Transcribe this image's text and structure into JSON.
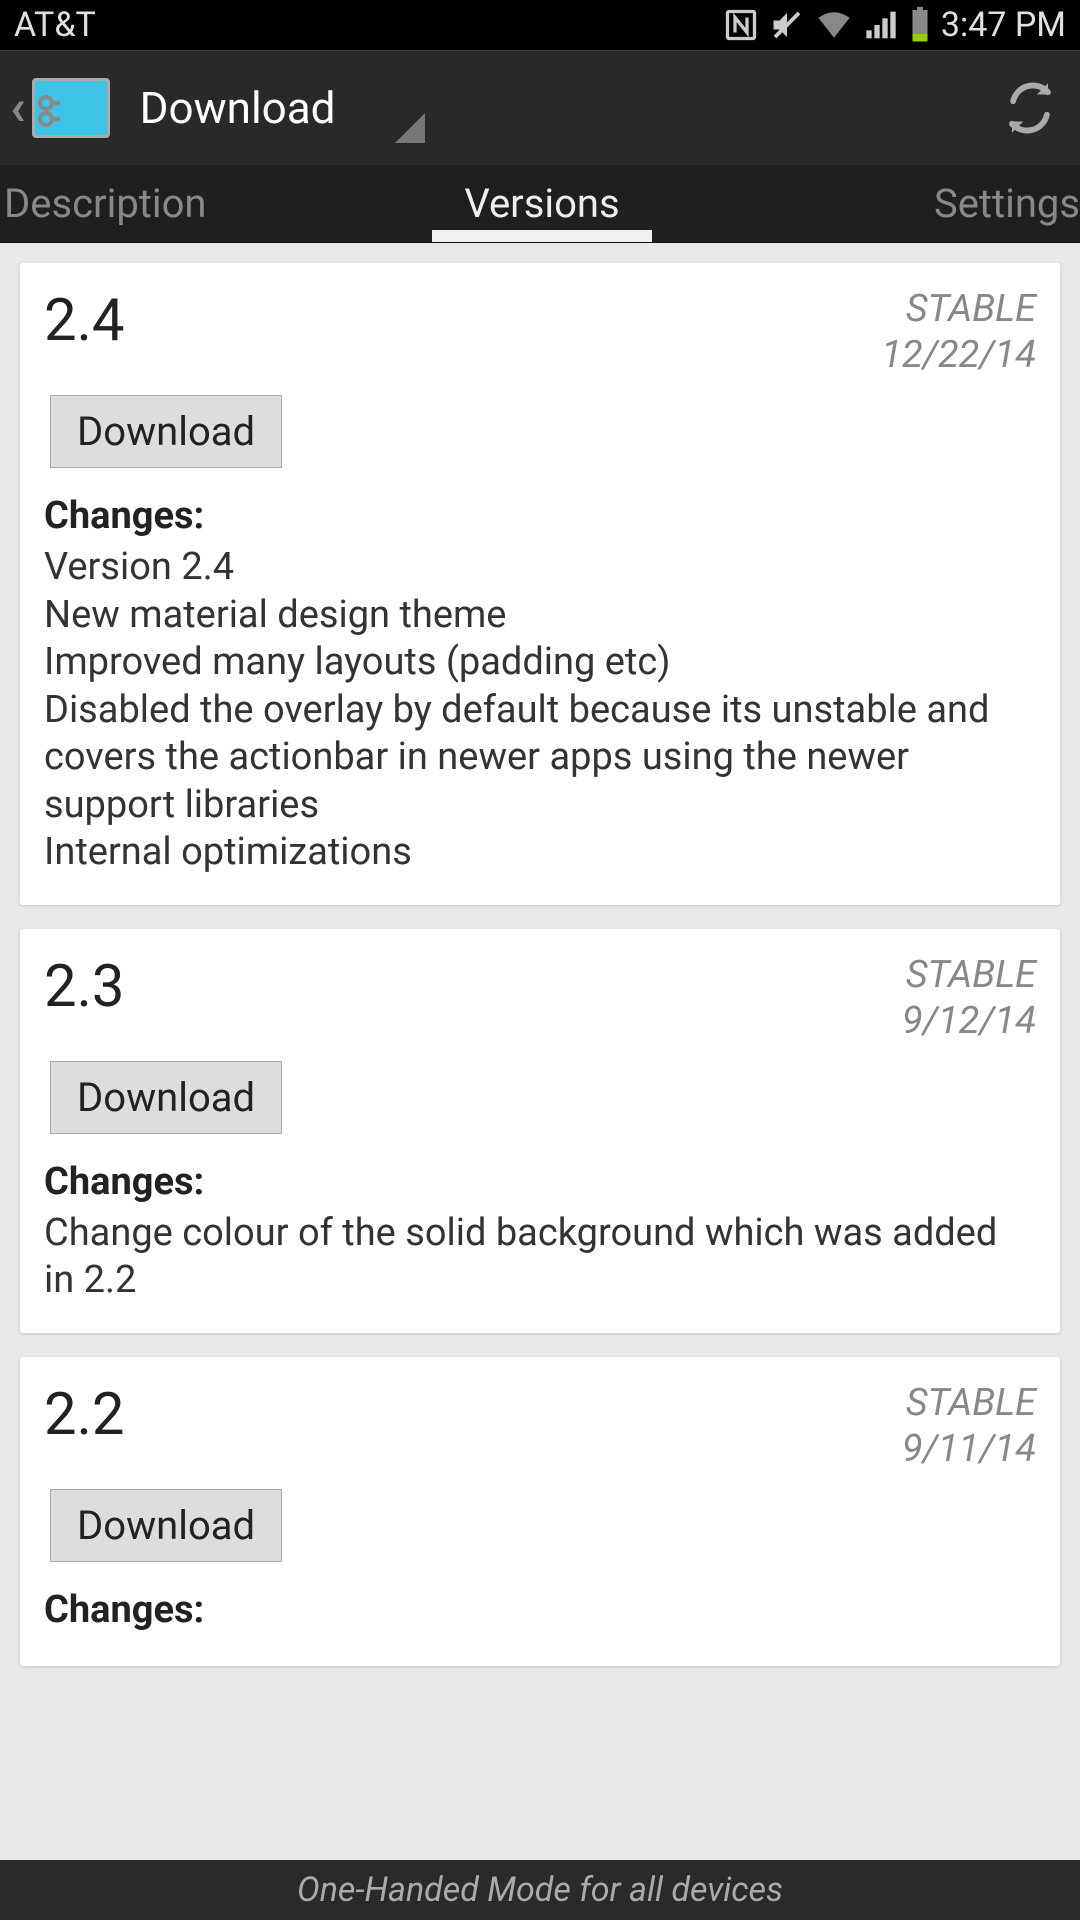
{
  "status_bar": {
    "carrier": "AT&T",
    "time": "3:47 PM"
  },
  "action_bar": {
    "title": "Download"
  },
  "tabs": [
    {
      "label": "Description"
    },
    {
      "label": "Versions"
    },
    {
      "label": "Settings"
    }
  ],
  "versions": [
    {
      "version": "2.4",
      "stability": "STABLE",
      "date": "12/22/14",
      "download_label": "Download",
      "changes_heading": "Changes:",
      "changes": "Version 2.4\nNew material design theme\nImproved many layouts (padding etc)\nDisabled the overlay by default because its unstable and covers the actionbar in newer apps using the newer support libraries\nInternal optimizations"
    },
    {
      "version": "2.3",
      "stability": "STABLE",
      "date": "9/12/14",
      "download_label": "Download",
      "changes_heading": "Changes:",
      "changes": "Change colour of the solid background which was added in 2.2"
    },
    {
      "version": "2.2",
      "stability": "STABLE",
      "date": "9/11/14",
      "download_label": "Download",
      "changes_heading": "Changes:",
      "changes": ""
    }
  ],
  "footer": {
    "text": "One-Handed Mode for all devices"
  }
}
